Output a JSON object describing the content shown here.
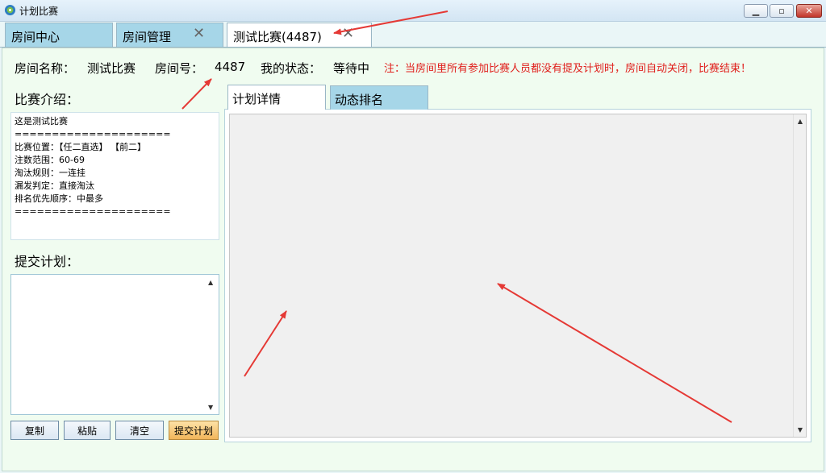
{
  "window": {
    "title": "计划比赛"
  },
  "tabs": [
    {
      "label": "房间中心"
    },
    {
      "label": "房间管理"
    },
    {
      "label": "测试比赛(4487)"
    }
  ],
  "room_info": {
    "name_label": "房间名称：",
    "name_value": "测试比赛",
    "number_label": "房间号：",
    "number_value": "4487",
    "status_label": "我的状态：",
    "status_value": "等待中",
    "note": "注：当房间里所有参加比赛人员都没有提及计划时，房间自动关闭，比赛结束！"
  },
  "intro": {
    "label": "比赛介绍：",
    "lines": [
      "这是测试比赛",
      "=====================",
      "比赛位置：【任二直选】 【前二】",
      "注数范围：60-69",
      "淘汰规则：一连挂",
      "漏发判定：直接淘汰",
      "排名优先顺序：中最多",
      "====================="
    ]
  },
  "plan": {
    "label": "提交计划：",
    "value": ""
  },
  "buttons": {
    "copy": "复制",
    "paste": "粘贴",
    "clear": "清空",
    "submit": "提交计划"
  },
  "inner_tabs": [
    {
      "label": "计划详情"
    },
    {
      "label": "动态排名"
    }
  ],
  "colors": {
    "annotation_arrow": "#e53935",
    "note_text": "#e0201c",
    "tab_inactive": "#a6d6e8"
  }
}
